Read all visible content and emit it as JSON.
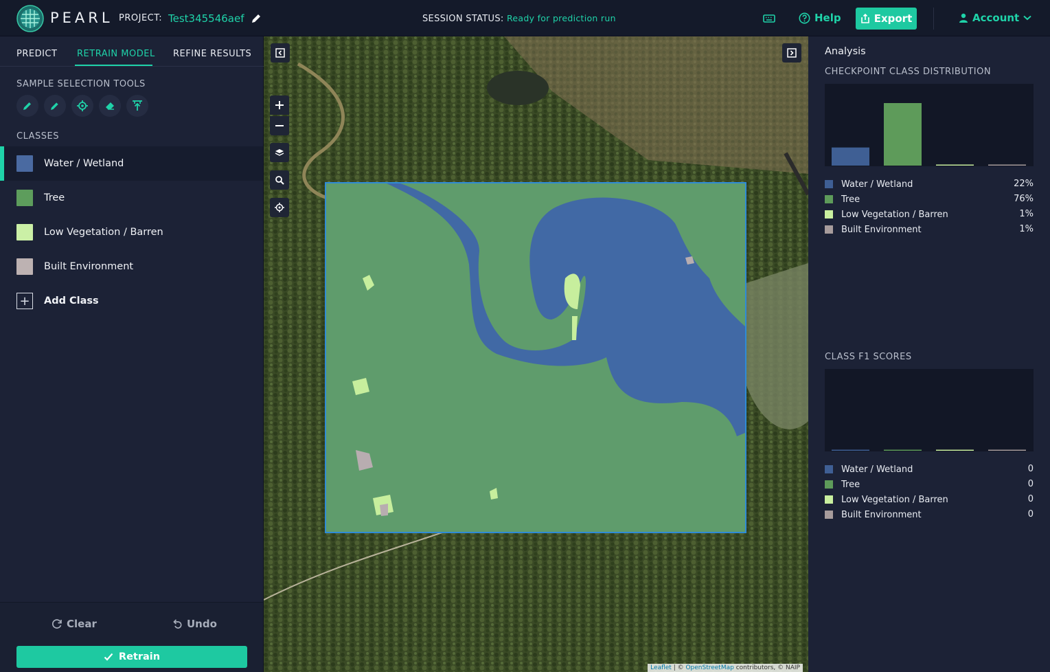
{
  "header": {
    "brand": "PEARL",
    "project_label": "PROJECT:",
    "project_name": "Test345546aef",
    "status_label": "SESSION STATUS:",
    "status_value": "Ready for prediction run",
    "help_label": "Help",
    "export_label": "Export",
    "account_label": "Account"
  },
  "left_panel": {
    "tabs": [
      {
        "label": "PREDICT",
        "active": false
      },
      {
        "label": "RETRAIN MODEL",
        "active": true
      },
      {
        "label": "REFINE RESULTS",
        "active": false
      }
    ],
    "tools_title": "SAMPLE SELECTION TOOLS",
    "tools": [
      "polygon-pencil-icon",
      "freehand-pencil-icon",
      "point-target-icon",
      "eraser-icon",
      "upload-icon"
    ],
    "classes_title": "CLASSES",
    "classes": [
      {
        "label": "Water / Wetland",
        "color": "#4a6aa1",
        "active": true
      },
      {
        "label": "Tree",
        "color": "#5d9d5c",
        "active": false
      },
      {
        "label": "Low Vegetation / Barren",
        "color": "#cbf0a6",
        "active": false
      },
      {
        "label": "Built Environment",
        "color": "#bdb2b2",
        "active": false
      }
    ],
    "add_class_label": "Add Class",
    "clear_label": "Clear",
    "undo_label": "Undo",
    "retrain_label": "Retrain"
  },
  "map": {
    "attribution_leaflet": "Leaflet",
    "attribution_sep": " | © ",
    "attribution_osm": "OpenStreetMap",
    "attribution_rest": " contributors, © NAIP"
  },
  "right_panel": {
    "title": "Analysis",
    "distribution_title": "CHECKPOINT CLASS DISTRIBUTION",
    "f1_title": "CLASS F1 SCORES",
    "colors": {
      "water": "#3f5f94",
      "tree": "#5e9b5a",
      "lowveg": "#c9ef9f",
      "built": "#a79c9c"
    }
  },
  "chart_data": [
    {
      "type": "bar",
      "title": "CHECKPOINT CLASS DISTRIBUTION",
      "categories": [
        "Water / Wetland",
        "Tree",
        "Low Vegetation / Barren",
        "Built Environment"
      ],
      "values": [
        22,
        76,
        1,
        1
      ],
      "value_labels": [
        "22%",
        "76%",
        "1%",
        "1%"
      ],
      "ylim": [
        0,
        76
      ],
      "legend": "below"
    },
    {
      "type": "bar",
      "title": "CLASS F1 SCORES",
      "categories": [
        "Water / Wetland",
        "Tree",
        "Low Vegetation / Barren",
        "Built Environment"
      ],
      "values": [
        0,
        0,
        0,
        0
      ],
      "value_labels": [
        "0",
        "0",
        "0",
        "0"
      ],
      "legend": "below"
    }
  ]
}
